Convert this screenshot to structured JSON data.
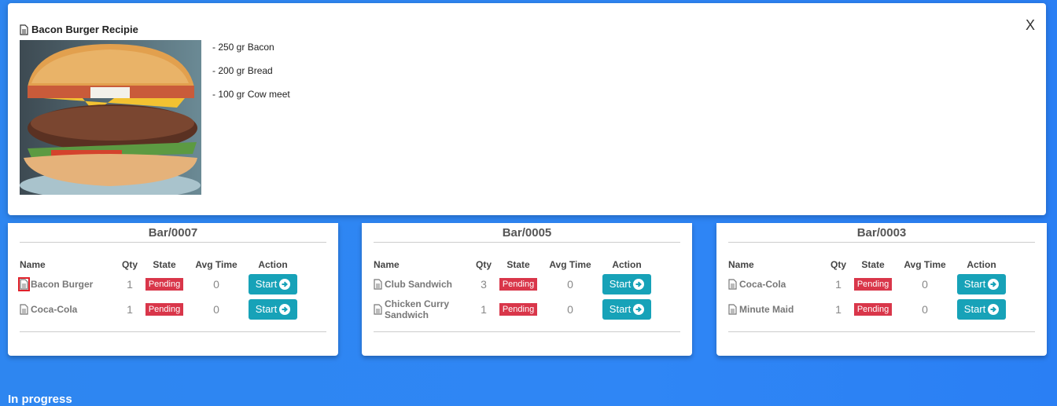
{
  "modal": {
    "title": "Bacon Burger Recipie",
    "close_label": "X",
    "ingredients": [
      "- 250 gr Bacon",
      "- 200 gr Bread",
      "- 100 gr Cow meet"
    ]
  },
  "columns": {
    "name": "Name",
    "qty": "Qty",
    "state": "State",
    "avg_time": "Avg Time",
    "action": "Action"
  },
  "cards": [
    {
      "title": "Bar/0007",
      "rows": [
        {
          "name": "Bacon Burger",
          "qty": "1",
          "state": "Pending",
          "avg": "0",
          "action": "Start"
        },
        {
          "name": "Coca-Cola",
          "qty": "1",
          "state": "Pending",
          "avg": "0",
          "action": "Start"
        }
      ]
    },
    {
      "title": "Bar/0005",
      "rows": [
        {
          "name": "Club Sandwich",
          "qty": "3",
          "state": "Pending",
          "avg": "0",
          "action": "Start"
        },
        {
          "name": "Chicken Curry Sandwich",
          "qty": "1",
          "state": "Pending",
          "avg": "0",
          "action": "Start"
        }
      ]
    },
    {
      "title": "Bar/0003",
      "rows": [
        {
          "name": "Coca-Cola",
          "qty": "1",
          "state": "Pending",
          "avg": "0",
          "action": "Start"
        },
        {
          "name": "Minute Maid",
          "qty": "1",
          "state": "Pending",
          "avg": "0",
          "action": "Start"
        }
      ]
    }
  ],
  "section_in_progress": "In progress",
  "colors": {
    "badge": "#d9364a",
    "button": "#17a2b8",
    "background": "#2e86f0"
  },
  "icons": {
    "item": "document-icon",
    "action": "arrow-circle-right-icon"
  }
}
